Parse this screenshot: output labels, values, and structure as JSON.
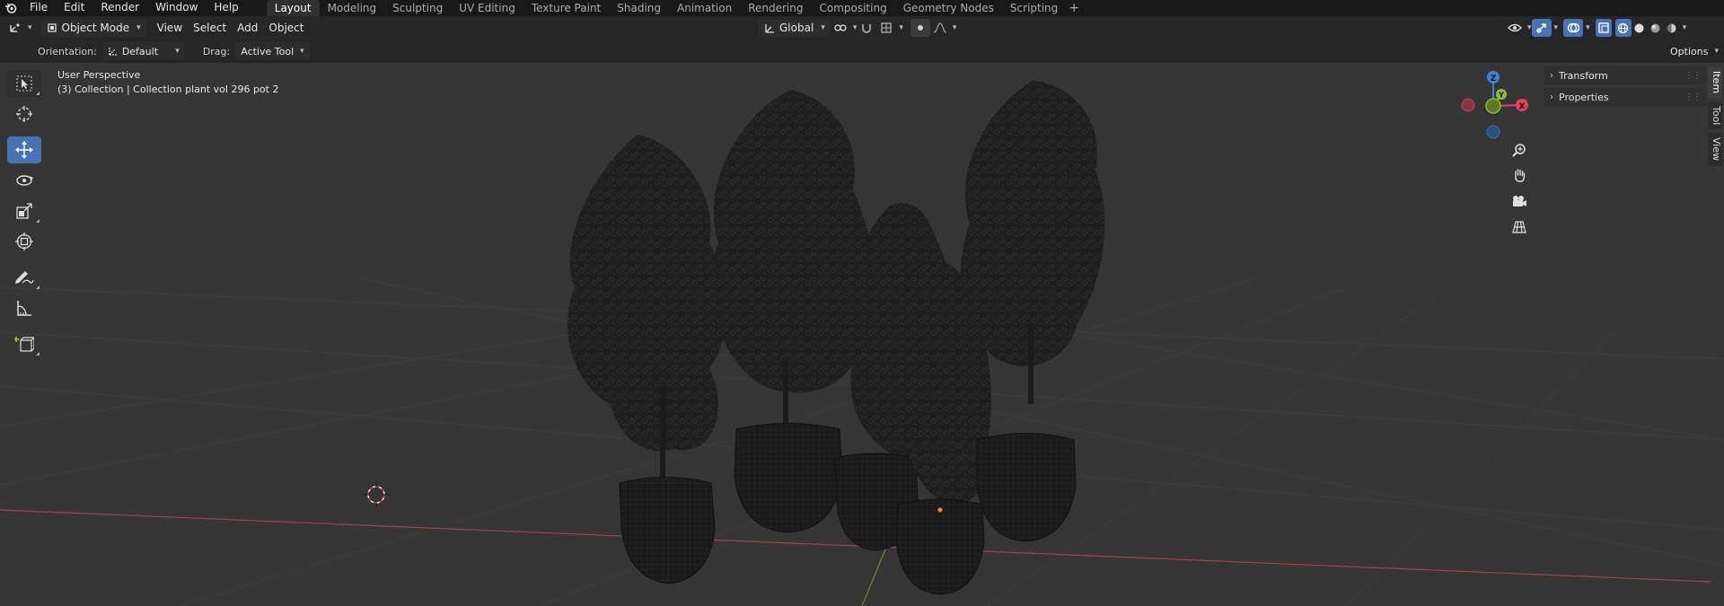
{
  "menu": [
    "File",
    "Edit",
    "Render",
    "Window",
    "Help"
  ],
  "workspaces": [
    {
      "label": "Layout",
      "active": true
    },
    {
      "label": "Modeling"
    },
    {
      "label": "Sculpting"
    },
    {
      "label": "UV Editing"
    },
    {
      "label": "Texture Paint"
    },
    {
      "label": "Shading"
    },
    {
      "label": "Animation"
    },
    {
      "label": "Rendering"
    },
    {
      "label": "Compositing"
    },
    {
      "label": "Geometry Nodes"
    },
    {
      "label": "Scripting"
    }
  ],
  "workspace_add": "+",
  "header": {
    "mode": "Object Mode",
    "menus": [
      "View",
      "Select",
      "Add",
      "Object"
    ],
    "transform_orientation": "Global",
    "options_label": "Options"
  },
  "toolsettings": {
    "orientation_label": "Orientation:",
    "orientation_value": "Default",
    "drag_label": "Drag:",
    "drag_value": "Active Tool"
  },
  "viewport": {
    "perspective": "User Perspective",
    "collection": "(3) Collection | Collection plant vol 296 pot 2"
  },
  "gizmo": {
    "z": "Z",
    "y": "Y",
    "x": "X"
  },
  "sidebar": {
    "panels": [
      "Transform",
      "Properties"
    ],
    "tabs": [
      {
        "label": "Item",
        "active": true
      },
      {
        "label": "Tool"
      },
      {
        "label": "View"
      }
    ]
  },
  "colors": {
    "accent": "#4772b3",
    "axis_x": "#e0425a",
    "axis_y": "#8cbc34",
    "axis_z": "#3a83d6",
    "viewport_bg": "#353535"
  }
}
